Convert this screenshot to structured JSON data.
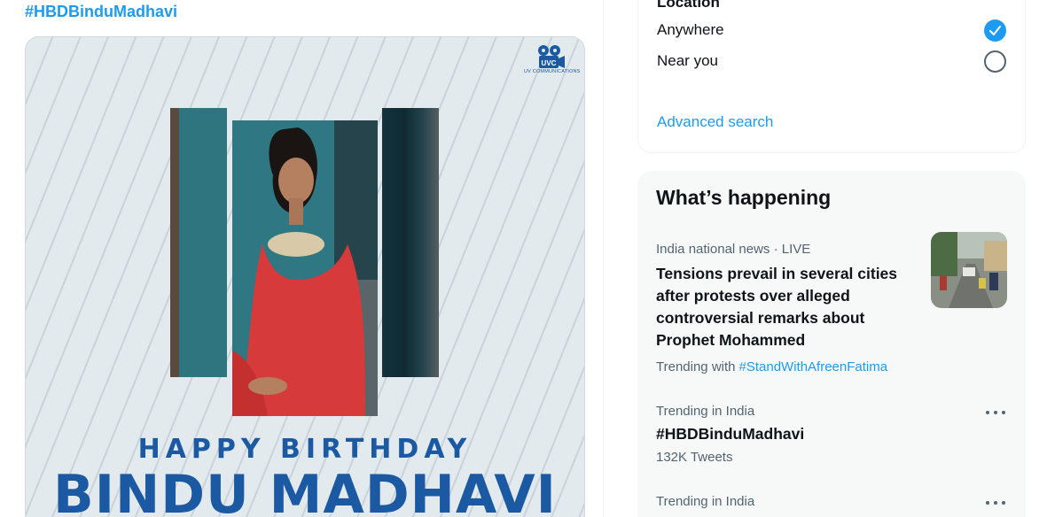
{
  "tweet": {
    "hashtag": "#HBDBinduMadhavi",
    "media": {
      "logo_text": "UVC",
      "logo_caption": "UV COMMUNICATIONS",
      "line1": "HAPPY BIRTHDAY",
      "line2": "BINDU MADHAVI"
    }
  },
  "search_filters": {
    "section_title": "Location",
    "options": [
      {
        "label": "Anywhere",
        "checked": true
      },
      {
        "label": "Near you",
        "checked": false
      }
    ],
    "advanced_search": "Advanced search"
  },
  "whats_happening": {
    "title": "What’s happening",
    "trends": [
      {
        "meta": "India national news · LIVE",
        "headline": "Tensions prevail in several cities after protests over alleged controversial remarks about Prophet Mohammed",
        "trending_with_label": "Trending with",
        "trending_with_tag": "#StandWithAfreenFatima"
      },
      {
        "meta": "Trending in India",
        "name": "#HBDBinduMadhavi",
        "count": "132K Tweets"
      },
      {
        "meta": "Trending in India"
      }
    ]
  },
  "colors": {
    "accent": "#1d9bf0",
    "brand_blue": "#1b5aa3",
    "secondary_text": "#536471",
    "panel_bg": "#f7f9f9"
  },
  "icons": [
    "uvc-film-reel-icon",
    "checkmark-icon",
    "more-options-icon"
  ]
}
